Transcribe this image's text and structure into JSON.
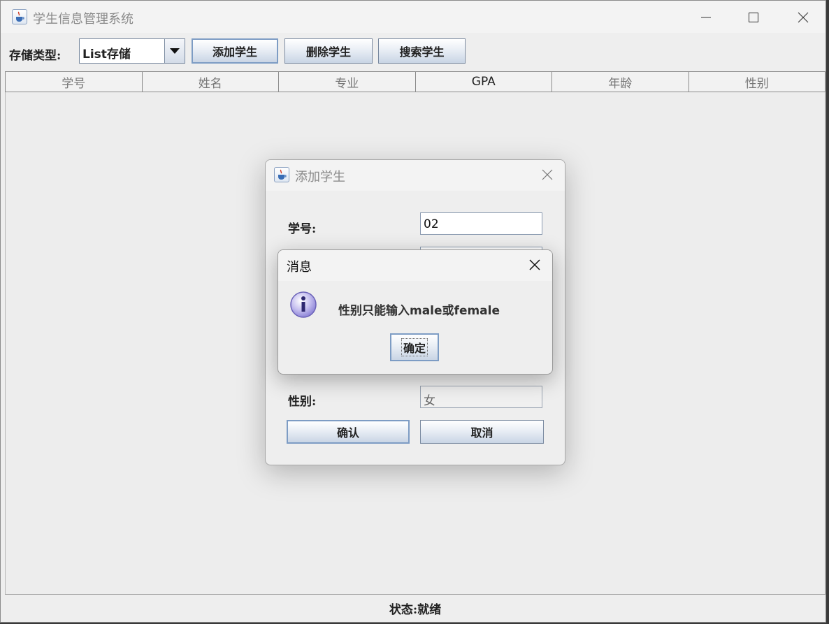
{
  "window": {
    "title": "学生信息管理系统"
  },
  "toolbar": {
    "storage_label": "存储类型:",
    "storage_value": "List存储",
    "add_button": "添加学生",
    "delete_button": "删除学生",
    "search_button": "搜索学生"
  },
  "table": {
    "columns": [
      "学号",
      "姓名",
      "专业",
      "GPA",
      "年龄",
      "性别"
    ]
  },
  "status_bar": {
    "text": "状态:就绪"
  },
  "add_dialog": {
    "title": "添加学生",
    "fields": {
      "id_label": "学号:",
      "id_value": "02",
      "gender_label": "性别:",
      "gender_value": "女"
    },
    "confirm_button": "确认",
    "cancel_button": "取消"
  },
  "message_dialog": {
    "title": "消息",
    "text": "性别只能输入male或female",
    "ok_button": "确定"
  },
  "icons": {
    "app": "java-cup-icon",
    "info": "info-icon",
    "combo_arrow": "chevron-down-icon"
  },
  "colors": {
    "info_icon": "#8f86d8",
    "button_border": "#7a8aa0",
    "background": "#eeeeee"
  }
}
